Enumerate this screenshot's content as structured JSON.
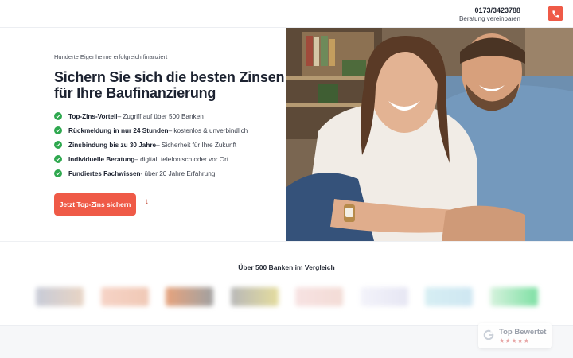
{
  "header": {
    "phone": "0173/3423788",
    "cta": "Beratung vereinbaren",
    "phone_icon": "phone-icon",
    "accent": "#ef5a47"
  },
  "hero": {
    "eyebrow": "Hunderte Eigenheime erfolgreich finanziert",
    "headline": "Sichern Sie sich die besten Zinsen für Ihre Baufinanzierung",
    "features": [
      {
        "bold": "Top-Zins-Vorteil",
        "rest": " – Zugriff auf über 500 Banken"
      },
      {
        "bold": "Rückmeldung in nur 24 Stunden",
        "rest": " – kostenlos & unverbindlich"
      },
      {
        "bold": "Zinsbindung bis zu 30 Jahre",
        "rest": " – Sicherheit für Ihre Zukunft"
      },
      {
        "bold": "Individuelle Beratung",
        "rest": " – digital, telefonisch oder vor Ort"
      },
      {
        "bold": "Fundiertes Fachwissen",
        "rest": " - über 20 Jahre Erfahrung"
      }
    ],
    "cta": "Jetzt Top-Zins sichern",
    "check_color": "#2fa84f",
    "scroll_icon": "arrow-down-icon"
  },
  "banks": {
    "title": "Über 500 Banken im Vergleich"
  },
  "rating": {
    "label": "Top Bewertet",
    "stars": "★★★★★",
    "icon": "google-icon"
  }
}
